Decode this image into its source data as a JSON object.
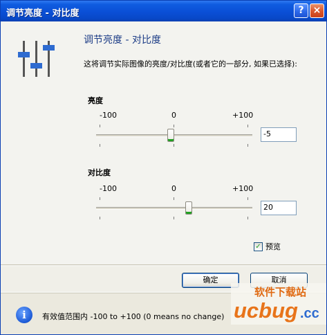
{
  "window": {
    "title": "调节亮度 - 对比度",
    "help_icon": "?",
    "close_icon": "×"
  },
  "header": {
    "title": "调节亮度 - 对比度",
    "description": "这将调节实际图像的亮度/对比度(或者它的一部分, 如果已选择):"
  },
  "brightness": {
    "label": "亮度",
    "min_label": "-100",
    "mid_label": "0",
    "max_label": "+100",
    "value": "-5",
    "level": -5
  },
  "contrast": {
    "label": "对比度",
    "min_label": "-100",
    "mid_label": "0",
    "max_label": "+100",
    "value": "20",
    "level": 20
  },
  "preview": {
    "label": "预览",
    "checked": true
  },
  "buttons": {
    "ok": "确定",
    "cancel": "取消"
  },
  "info": {
    "text": "有效值范围内 -100 to +100 (0 means no change)"
  },
  "watermark": {
    "text_cn": "软件下载站",
    "text_logo": "ucbug",
    "text_domain": ".cc"
  },
  "colors": {
    "accent": "#0a4fd6",
    "slider_green": "#21a121",
    "title_blue": "#1c3c86"
  }
}
